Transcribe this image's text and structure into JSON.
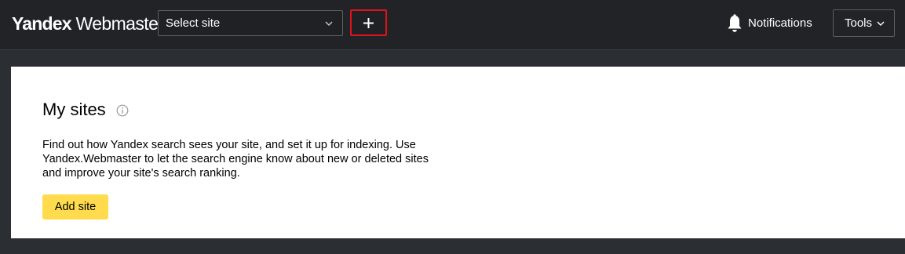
{
  "header": {
    "logo_brand": "Yandex",
    "logo_product": "Webmaster",
    "site_select_value": "Select site",
    "add_button_label": "+",
    "notifications_label": "Notifications",
    "tools_label": "Tools"
  },
  "main": {
    "title": "My sites",
    "description": "Find out how Yandex search sees your site, and set it up for indexing. Use Yandex.Webmaster to let the search engine know about new or deleted sites and improve your site's search ranking.",
    "add_site_label": "Add site"
  },
  "icons": {
    "select_chevron": "chevron-down-icon",
    "add": "plus-icon",
    "notifications": "bell-icon",
    "tools_chevron": "chevron-down-icon",
    "info": "info-icon"
  },
  "colors": {
    "header_bg": "#212327",
    "page_bg": "#2b2e33",
    "highlight_border": "#e1121c",
    "primary_button": "#ffdb4d"
  }
}
